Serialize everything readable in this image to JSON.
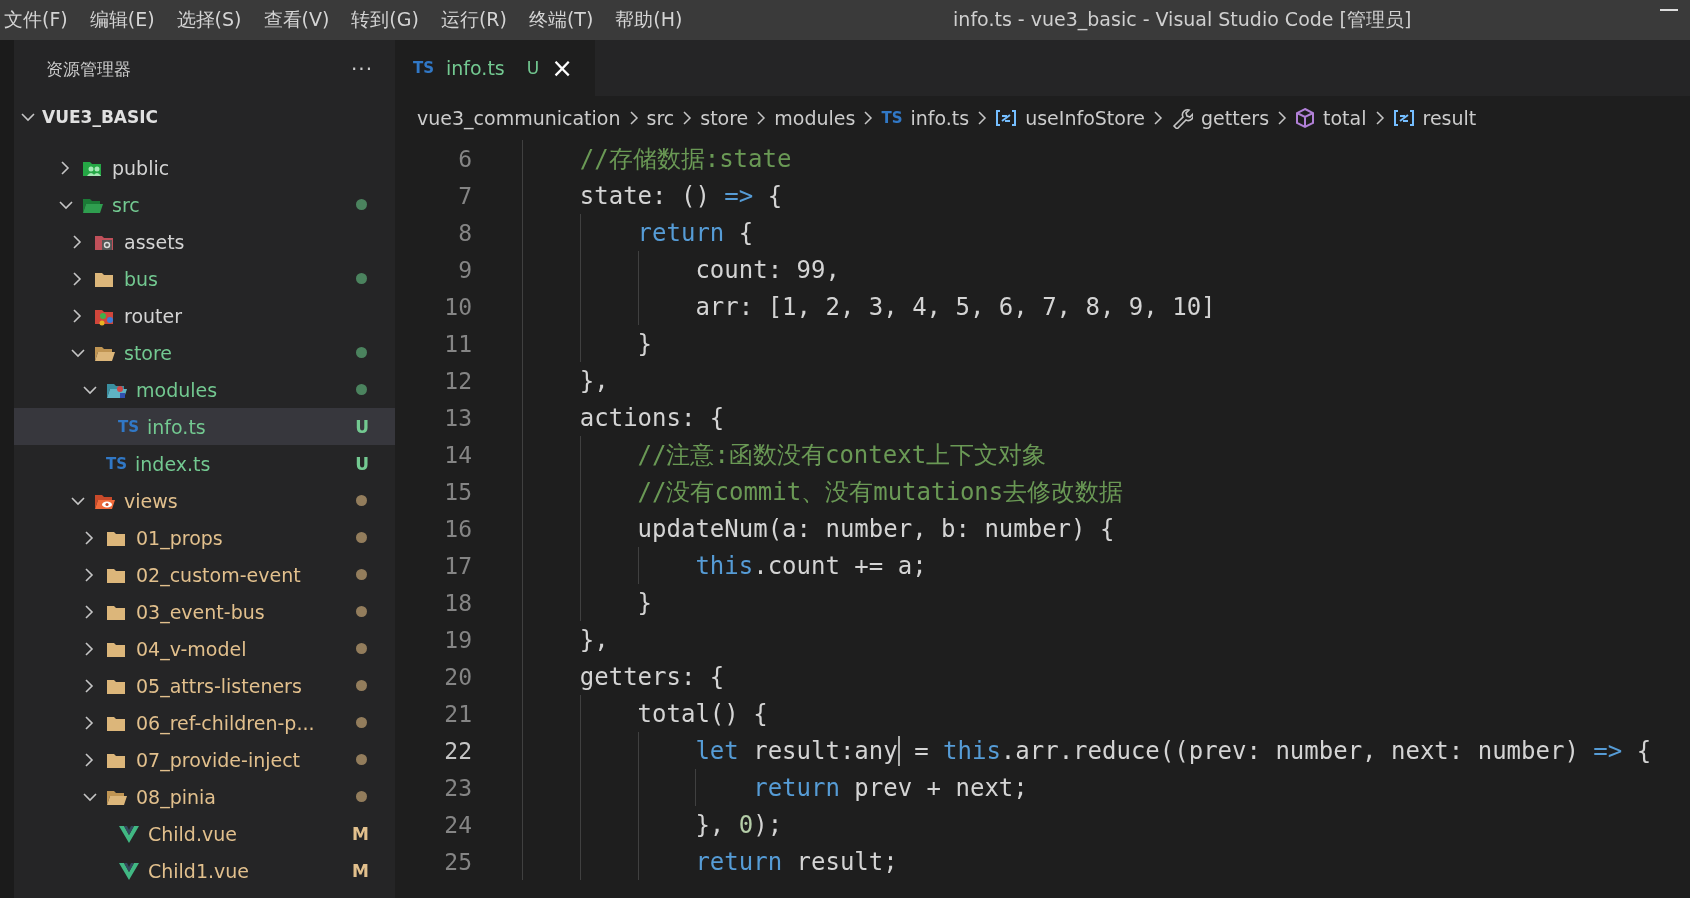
{
  "menu": [
    "文件(F)",
    "编辑(E)",
    "选择(S)",
    "查看(V)",
    "转到(G)",
    "运行(R)",
    "终端(T)",
    "帮助(H)"
  ],
  "window": {
    "title": "info.ts - vue3_basic - Visual Studio Code [管理员]"
  },
  "sidebar": {
    "title": "资源管理器",
    "more": "···",
    "section": {
      "label": "VUE3_BASIC",
      "expanded": true
    },
    "items": [
      {
        "label": "public",
        "kind": "public",
        "expanded": false,
        "color": "#d4d4d4",
        "dot": false
      },
      {
        "label": "src",
        "kind": "src",
        "expanded": true,
        "color": "#73c991",
        "dot": true,
        "children": [
          {
            "label": "assets",
            "kind": "assets",
            "expanded": false,
            "color": "#d4d4d4",
            "dot": false
          },
          {
            "label": "bus",
            "kind": "folder",
            "expanded": false,
            "color": "#73c991",
            "dot": true
          },
          {
            "label": "router",
            "kind": "router",
            "expanded": false,
            "color": "#d4d4d4",
            "dot": false
          },
          {
            "label": "store",
            "kind": "folder",
            "expanded": true,
            "color": "#73c991",
            "dot": true,
            "children": [
              {
                "label": "modules",
                "kind": "modules",
                "expanded": true,
                "color": "#73c991",
                "dot": true,
                "children": [
                  {
                    "label": "info.ts",
                    "kind": "ts",
                    "icon_text": "TS",
                    "color": "#73c991",
                    "badge": "U",
                    "selected": true
                  }
                ]
              },
              {
                "label": "index.ts",
                "kind": "ts",
                "icon_text": "TS",
                "color": "#73c991",
                "badge": "U",
                "selected": false
              }
            ]
          },
          {
            "label": "views",
            "kind": "views",
            "expanded": true,
            "color": "#e2c08d",
            "dot": true,
            "children": [
              {
                "label": "01_props",
                "kind": "folder",
                "expanded": false,
                "color": "#e2c08d",
                "dot": true
              },
              {
                "label": "02_custom-event",
                "kind": "folder",
                "expanded": false,
                "color": "#e2c08d",
                "dot": true
              },
              {
                "label": "03_event-bus",
                "kind": "folder",
                "expanded": false,
                "color": "#e2c08d",
                "dot": true
              },
              {
                "label": "04_v-model",
                "kind": "folder",
                "expanded": false,
                "color": "#e2c08d",
                "dot": true
              },
              {
                "label": "05_attrs-listeners",
                "kind": "folder",
                "expanded": false,
                "color": "#e2c08d",
                "dot": true
              },
              {
                "label": "06_ref-children-p...",
                "kind": "folder",
                "expanded": false,
                "color": "#e2c08d",
                "dot": true
              },
              {
                "label": "07_provide-inject",
                "kind": "folder",
                "expanded": false,
                "color": "#e2c08d",
                "dot": true
              },
              {
                "label": "08_pinia",
                "kind": "folder",
                "expanded": true,
                "color": "#e2c08d",
                "dot": true,
                "children": [
                  {
                    "label": "Child.vue",
                    "kind": "vue",
                    "color": "#e2c08d",
                    "badge": "M",
                    "selected": false
                  },
                  {
                    "label": "Child1.vue",
                    "kind": "vue",
                    "color": "#e2c08d",
                    "badge": "M",
                    "selected": false
                  }
                ]
              }
            ]
          }
        ]
      }
    ]
  },
  "tabs": [
    {
      "icon_text": "TS",
      "label": "info.ts",
      "badge": "U",
      "close": "×",
      "selected": true
    }
  ],
  "breadcrumb": [
    {
      "label": "vue3_communication",
      "kind": "plain"
    },
    {
      "label": "src",
      "kind": "plain"
    },
    {
      "label": "store",
      "kind": "plain"
    },
    {
      "label": "modules",
      "kind": "plain"
    },
    {
      "label": "info.ts",
      "kind": "ts",
      "icon_text": "TS"
    },
    {
      "label": "useInfoStore",
      "kind": "variable"
    },
    {
      "label": "getters",
      "kind": "wrench"
    },
    {
      "label": "total",
      "kind": "cube"
    },
    {
      "label": "result",
      "kind": "variable"
    }
  ],
  "editor": {
    "lines": [
      {
        "number": "6",
        "current": false,
        "tokens": [
          {
            "text": "    //存储数据:state",
            "kind": "comment"
          }
        ]
      },
      {
        "number": "7",
        "current": false,
        "tokens": [
          {
            "text": "    state: () ",
            "kind": "plain"
          },
          {
            "text": "=>",
            "kind": "keyword"
          },
          {
            "text": " {",
            "kind": "plain"
          }
        ]
      },
      {
        "number": "8",
        "current": false,
        "tokens": [
          {
            "text": "        return",
            "kind": "keyword"
          },
          {
            "text": " {",
            "kind": "plain"
          }
        ]
      },
      {
        "number": "9",
        "current": false,
        "tokens": [
          {
            "text": "            count: 99,",
            "kind": "plain"
          }
        ]
      },
      {
        "number": "10",
        "current": false,
        "tokens": [
          {
            "text": "            arr: [1, 2, 3, 4, 5, 6, 7, 8, 9, 10]",
            "kind": "plain"
          }
        ]
      },
      {
        "number": "11",
        "current": false,
        "tokens": [
          {
            "text": "        }",
            "kind": "plain"
          }
        ]
      },
      {
        "number": "12",
        "current": false,
        "tokens": [
          {
            "text": "    },",
            "kind": "plain"
          }
        ]
      },
      {
        "number": "13",
        "current": false,
        "tokens": [
          {
            "text": "    actions: {",
            "kind": "plain"
          }
        ]
      },
      {
        "number": "14",
        "current": false,
        "tokens": [
          {
            "text": "        //注意:函数没有context上下文对象",
            "kind": "comment"
          }
        ]
      },
      {
        "number": "15",
        "current": false,
        "tokens": [
          {
            "text": "        //没有commit、没有mutations去修改数据",
            "kind": "comment"
          }
        ]
      },
      {
        "number": "16",
        "current": false,
        "tokens": [
          {
            "text": "        updateNum(a: number, b: number) {",
            "kind": "plain"
          }
        ]
      },
      {
        "number": "17",
        "current": false,
        "tokens": [
          {
            "text": "            this",
            "kind": "keyword"
          },
          {
            "text": ".count += a;",
            "kind": "plain"
          }
        ]
      },
      {
        "number": "18",
        "current": false,
        "tokens": [
          {
            "text": "        }",
            "kind": "plain"
          }
        ]
      },
      {
        "number": "19",
        "current": false,
        "tokens": [
          {
            "text": "    },",
            "kind": "plain"
          }
        ]
      },
      {
        "number": "20",
        "current": false,
        "tokens": [
          {
            "text": "    getters: {",
            "kind": "plain"
          }
        ]
      },
      {
        "number": "21",
        "current": false,
        "tokens": [
          {
            "text": "        total() {",
            "kind": "plain"
          }
        ]
      },
      {
        "number": "22",
        "current": true,
        "tokens": [
          {
            "text": "            let",
            "kind": "keyword"
          },
          {
            "text": " result:any",
            "kind": "plain",
            "caret": true
          },
          {
            "text": " = ",
            "kind": "plain"
          },
          {
            "text": "this",
            "kind": "keyword"
          },
          {
            "text": ".arr.reduce((prev: number, next: number) ",
            "kind": "plain"
          },
          {
            "text": "=>",
            "kind": "keyword"
          },
          {
            "text": " {",
            "kind": "plain"
          }
        ]
      },
      {
        "number": "23",
        "current": false,
        "tokens": [
          {
            "text": "                return",
            "kind": "keyword"
          },
          {
            "text": " prev + next;",
            "kind": "plain"
          }
        ]
      },
      {
        "number": "24",
        "current": false,
        "tokens": [
          {
            "text": "            }, ",
            "kind": "plain"
          },
          {
            "text": "0",
            "kind": "number"
          },
          {
            "text": ");",
            "kind": "plain"
          }
        ]
      },
      {
        "number": "25",
        "current": false,
        "tokens": [
          {
            "text": "            return",
            "kind": "keyword"
          },
          {
            "text": " result;",
            "kind": "plain"
          }
        ]
      }
    ]
  }
}
